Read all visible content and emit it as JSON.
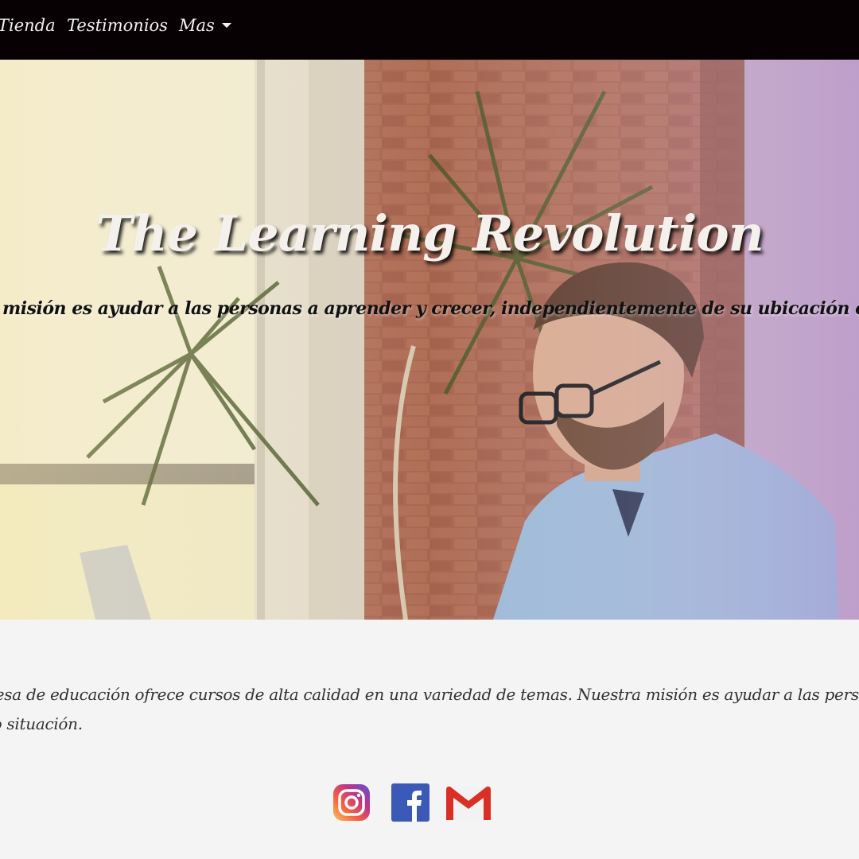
{
  "nav": {
    "items": [
      {
        "label": "Tienda"
      },
      {
        "label": "Testimonios"
      },
      {
        "label": "Mas"
      }
    ]
  },
  "hero": {
    "title": "The Learning Revolution",
    "subtitle": "ra misión es ayudar a las personas a aprender y crecer, independientemente de su ubicación o situación"
  },
  "about": {
    "line1": "presa de educación ofrece cursos de alta calidad en una variedad de temas. Nuestra misión es ayudar a las personas",
    "line2": "n o situación."
  },
  "social": {
    "icons": [
      "instagram-icon",
      "facebook-icon",
      "gmail-icon"
    ],
    "colors": {
      "instagram": "#c13584",
      "facebook": "#3b5998",
      "gmail": "#d93025"
    }
  },
  "colors": {
    "navbar": "#070104",
    "page_bg": "#f4f4f4"
  }
}
